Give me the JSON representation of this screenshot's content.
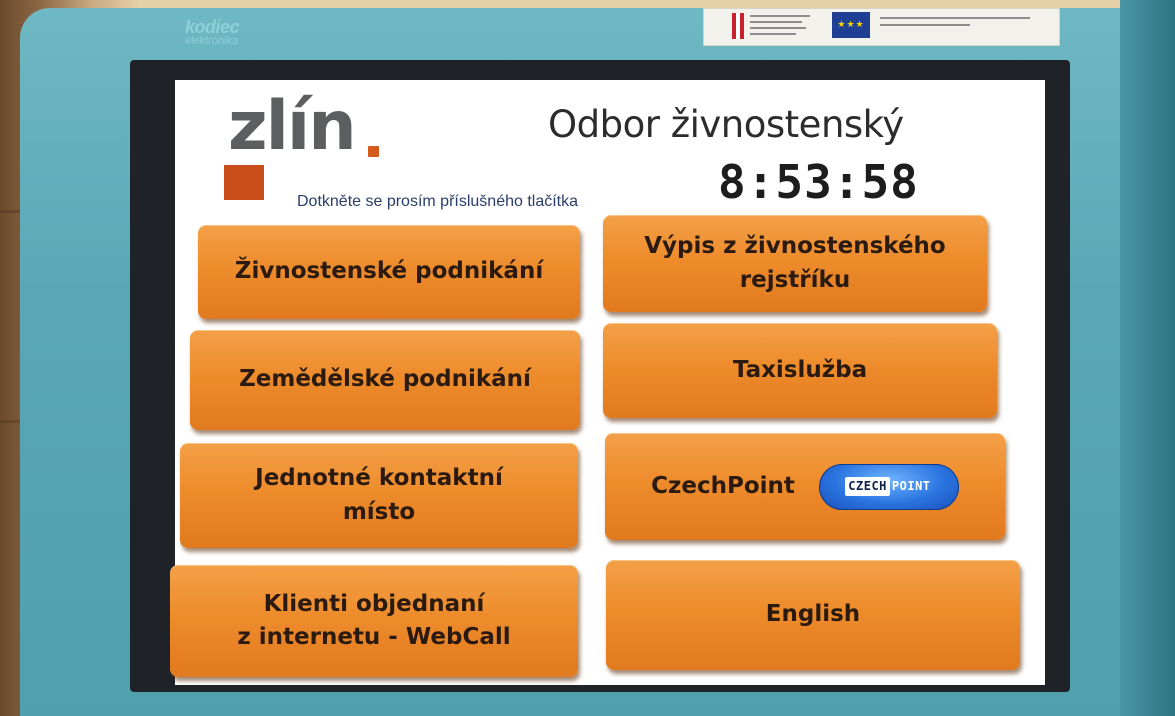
{
  "kiosk": {
    "manufacturer": {
      "name": "kodiec",
      "tagline": "elektronika"
    }
  },
  "screen": {
    "logo": {
      "word": "zlín"
    },
    "department_title": "Odbor živnostenský",
    "clock": "8:53:58",
    "instruction": "Dotkněte se prosím příslušného tlačítka",
    "menu": [
      {
        "lines": [
          "Živnostenské podnikání"
        ]
      },
      {
        "lines": [
          "Výpis z živnostenského",
          "rejstříku"
        ]
      },
      {
        "lines": [
          "Zemědělské podnikání"
        ]
      },
      {
        "lines": [
          "Taxislužba"
        ]
      },
      {
        "lines": [
          "Jednotné kontaktní",
          "místo"
        ]
      },
      {
        "lines": [
          "CzechPoint"
        ],
        "badge": {
          "part1": "CZECH",
          "part2": "POINT"
        }
      },
      {
        "lines": [
          "Klienti objednaní",
          "z internetu - WebCall"
        ]
      },
      {
        "lines": [
          "English"
        ]
      }
    ]
  },
  "colors": {
    "button": "#ee8c2c",
    "housing": "#5aa8b6",
    "logo_accent": "#c94e1c"
  }
}
